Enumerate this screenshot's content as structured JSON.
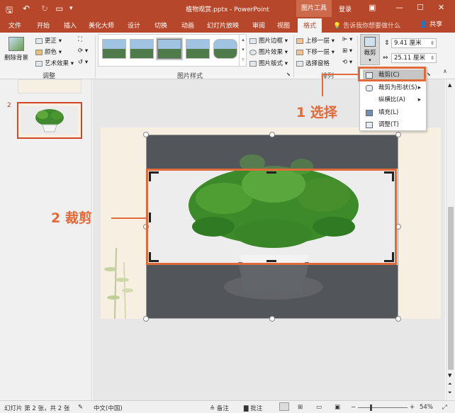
{
  "window": {
    "title": "植物观赏.pptx - PowerPoint",
    "context_tab": "图片工具",
    "login": "登录"
  },
  "tabs": [
    "文件",
    "开始",
    "插入",
    "美化大师",
    "设计",
    "切换",
    "动画",
    "幻灯片放映",
    "审阅",
    "视图",
    "格式"
  ],
  "active_tab": "格式",
  "tell_me": "告诉我你想要做什么",
  "share": "共享",
  "ribbon": {
    "remove_bg": "删除背景",
    "corrections": "更正",
    "color": "颜色",
    "artistic": "艺术效果",
    "adjust_label": "调整",
    "styles_label": "图片样式",
    "border": "图片边框",
    "effects": "图片效果",
    "layout": "图片版式",
    "bring_forward": "上移一层",
    "send_backward": "下移一层",
    "selection_pane": "选择窗格",
    "arrange_label": "排列",
    "crop": "裁剪",
    "height_value": "9.41 厘米",
    "width_value": "25.11 厘米"
  },
  "crop_menu": {
    "crop": "裁剪(C)",
    "crop_to_shape": "裁剪为形状(S)",
    "aspect_ratio": "纵横比(A)",
    "fill": "填充(L)",
    "fit": "调整(T)"
  },
  "slides_panel": {
    "slide_number": "2"
  },
  "annotations": {
    "step1": "1 选择",
    "step2": "2 裁剪"
  },
  "status": {
    "slide_info": "幻灯片 第 2 张，共 2 张",
    "language": "中文(中国)",
    "notes": "备注",
    "comments": "批注",
    "zoom": "54%"
  },
  "colors": {
    "brand": "#b7472a",
    "annotation": "#e06a3a"
  }
}
